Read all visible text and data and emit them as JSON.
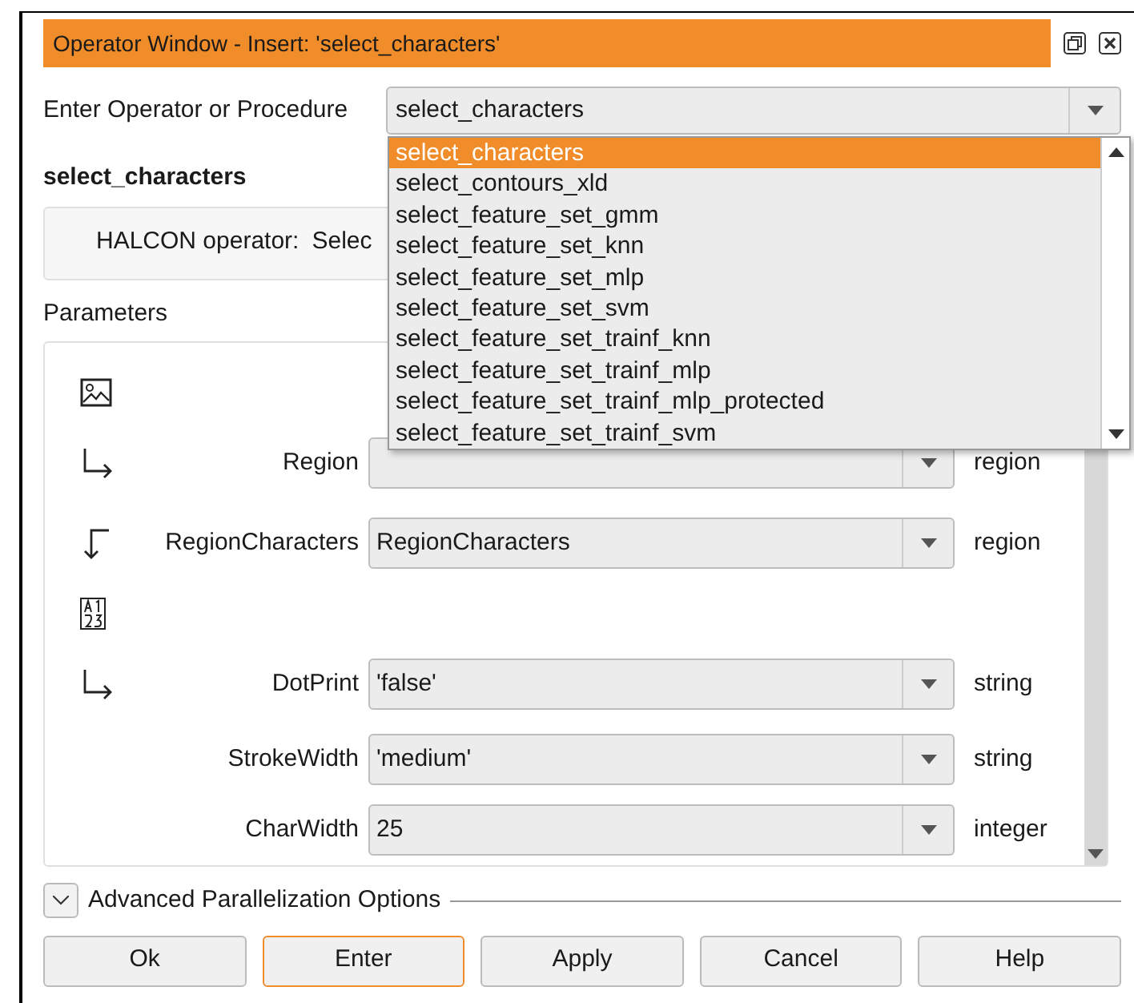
{
  "window": {
    "title": "Operator Window - Insert: 'select_characters'"
  },
  "operator_field": {
    "label": "Enter Operator or Procedure",
    "value": "select_characters"
  },
  "dropdown": {
    "items": [
      {
        "label": "select_characters",
        "selected": true
      },
      {
        "label": "select_contours_xld",
        "selected": false
      },
      {
        "label": "select_feature_set_gmm",
        "selected": false
      },
      {
        "label": "select_feature_set_knn",
        "selected": false
      },
      {
        "label": "select_feature_set_mlp",
        "selected": false
      },
      {
        "label": "select_feature_set_svm",
        "selected": false
      },
      {
        "label": "select_feature_set_trainf_knn",
        "selected": false
      },
      {
        "label": "select_feature_set_trainf_mlp",
        "selected": false
      },
      {
        "label": "select_feature_set_trainf_mlp_protected",
        "selected": false
      },
      {
        "label": "select_feature_set_trainf_svm",
        "selected": false
      }
    ]
  },
  "heading": "select_characters",
  "description": {
    "label": "HALCON operator:",
    "text": "Selec"
  },
  "parameters": {
    "title": "Parameters",
    "rows": [
      {
        "kind": "image"
      },
      {
        "kind": "output",
        "label": "Region",
        "unit": "region"
      },
      {
        "kind": "input",
        "label": "RegionCharacters",
        "value": "RegionCharacters",
        "unit": "region"
      },
      {
        "kind": "text"
      },
      {
        "kind": "output",
        "label": "DotPrint",
        "value": "'false'",
        "unit": "string"
      },
      {
        "kind": "plain",
        "label": "StrokeWidth",
        "value": "'medium'",
        "unit": "string"
      },
      {
        "kind": "plain",
        "label": "CharWidth",
        "value": "25",
        "unit": "integer"
      }
    ]
  },
  "advanced": {
    "label": "Advanced Parallelization Options",
    "expanded": false
  },
  "buttons": [
    {
      "label": "Ok",
      "focused": false
    },
    {
      "label": "Enter",
      "focused": true
    },
    {
      "label": "Apply",
      "focused": false
    },
    {
      "label": "Cancel",
      "focused": false
    },
    {
      "label": "Help",
      "focused": false
    }
  ]
}
